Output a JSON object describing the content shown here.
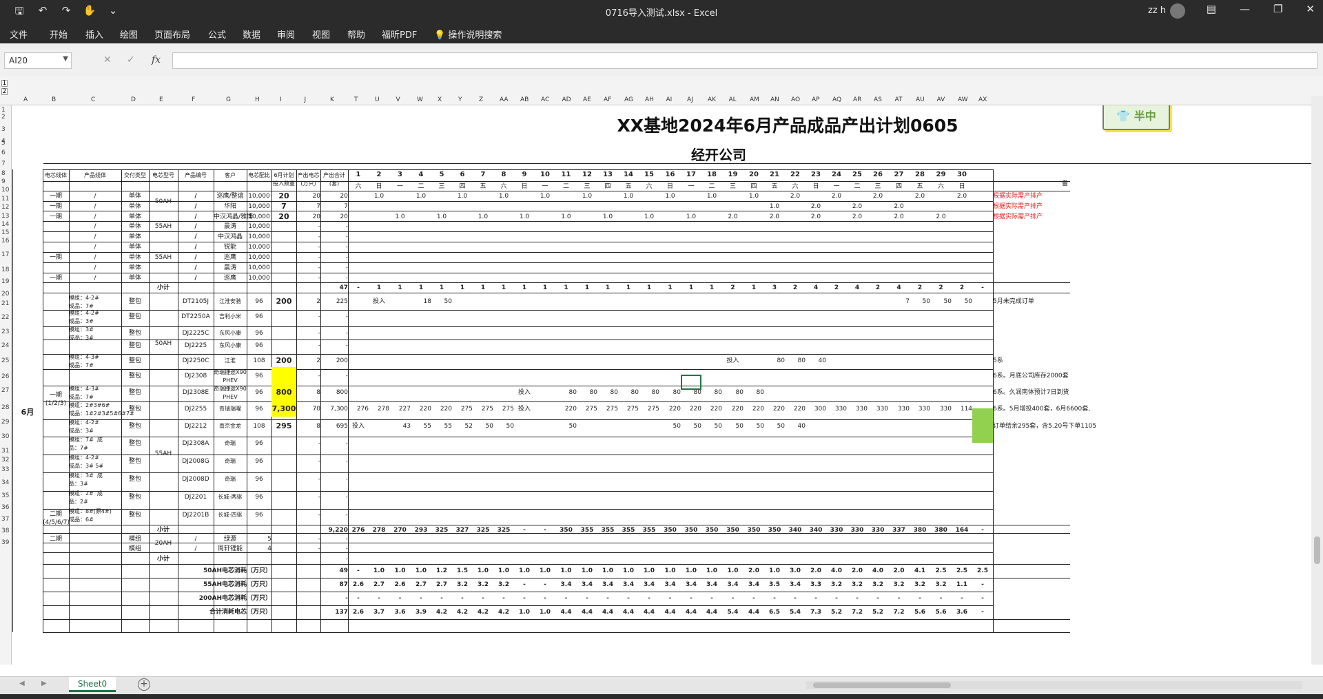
{
  "window": {
    "title": "0716导入测试.xlsx  -  Excel",
    "user": "zz h"
  },
  "menu": [
    "文件",
    "开始",
    "插入",
    "绘图",
    "页面布局",
    "公式",
    "数据",
    "审阅",
    "视图",
    "帮助",
    "福昕PDF",
    "操作说明搜索"
  ],
  "name_box": "AI20",
  "formula_value": "",
  "columns": [
    "A",
    "B",
    "C",
    "D",
    "E",
    "F",
    "G",
    "H",
    "I",
    "J",
    "K",
    "T",
    "U",
    "V",
    "W",
    "X",
    "Y",
    "Z",
    "AA",
    "AB",
    "AC",
    "AD",
    "AE",
    "AF",
    "AG",
    "AH",
    "AI",
    "AJ",
    "AK",
    "AL",
    "AM",
    "AN",
    "AO",
    "AP",
    "AQ",
    "AR",
    "AS",
    "AT",
    "AU",
    "AV",
    "AW",
    "AX"
  ],
  "rows": [
    "1",
    "2",
    "3",
    "4",
    "5",
    "6",
    "7",
    "8",
    "9",
    "10",
    "11",
    "12",
    "13",
    "14",
    "15",
    "16",
    "17",
    "18",
    "19",
    "20",
    "21",
    "22",
    "23",
    "24",
    "25",
    "26",
    "27",
    "28",
    "29",
    "30",
    "31",
    "32",
    "33",
    "34",
    "35",
    "36",
    "37",
    "38",
    "39"
  ],
  "sheet": {
    "title": "XX基地2024年6月产品成品产出计划0605",
    "company": "经开公司",
    "logo_text": "半中",
    "month": "6月",
    "headers": [
      "电芯线体",
      "产品线体",
      "交付类型",
      "电芯型号",
      "产品编号",
      "客户",
      "电芯配比",
      "6月计划投入数量",
      "产出电芯(万只)",
      "产出合计(套)"
    ],
    "days": [
      "1",
      "2",
      "3",
      "4",
      "5",
      "6",
      "7",
      "8",
      "9",
      "10",
      "11",
      "12",
      "13",
      "14",
      "15",
      "16",
      "17",
      "18",
      "19",
      "20",
      "21",
      "22",
      "23",
      "24",
      "25",
      "26",
      "27",
      "28",
      "29",
      "30"
    ],
    "weekdays": [
      "六",
      "日",
      "一",
      "二",
      "三",
      "四",
      "五",
      "六",
      "日",
      "一",
      "二",
      "三",
      "四",
      "五",
      "六",
      "日",
      "一",
      "二",
      "三",
      "四",
      "五",
      "六",
      "日",
      "一",
      "二",
      "三",
      "四",
      "五",
      "六",
      "日"
    ],
    "last_col": "备",
    "block1": [
      {
        "line": "一期",
        "pline": "/",
        "type": "单体",
        "cell": "50AH",
        "code": "/",
        "cust": "巡鹰/整谊",
        "ratio": "10,000",
        "plan": "20",
        "cells": "20",
        "total": "20",
        "note": "根据实际需产排产"
      },
      {
        "line": "一期",
        "pline": "/",
        "type": "单体",
        "cell": "",
        "code": "/",
        "cust": "华阳",
        "ratio": "10,000",
        "plan": "7",
        "cells": "7",
        "total": "7",
        "note": "根据实际需产排产"
      },
      {
        "line": "一期",
        "pline": "/",
        "type": "单体",
        "cell": "",
        "code": "/",
        "cust": "中汉鸿晶/雅博",
        "ratio": "10,000",
        "plan": "20",
        "cells": "20",
        "total": "20",
        "note": "根据实际需产排产"
      },
      {
        "line": "",
        "pline": "/",
        "type": "单体",
        "cell": "55AH",
        "code": "/",
        "cust": "晨涛",
        "ratio": "10,000",
        "plan": "",
        "cells": "-",
        "total": "-",
        "note": ""
      },
      {
        "line": "",
        "pline": "/",
        "type": "单体",
        "cell": "",
        "code": "/",
        "cust": "中汉鸿晶",
        "ratio": "10,000",
        "plan": "",
        "cells": "-",
        "total": "-",
        "note": ""
      },
      {
        "line": "",
        "pline": "/",
        "type": "单体",
        "cell": "",
        "code": "/",
        "cust": "锐能",
        "ratio": "10,000",
        "plan": "",
        "cells": "-",
        "total": "-",
        "note": ""
      },
      {
        "line": "一期",
        "pline": "/",
        "type": "单体",
        "cell": "55AH",
        "code": "/",
        "cust": "巡鹰",
        "ratio": "10,000",
        "plan": "",
        "cells": "-",
        "total": "-",
        "note": ""
      },
      {
        "line": "",
        "pline": "/",
        "type": "单体",
        "cell": "",
        "code": "/",
        "cust": "晨涛",
        "ratio": "10,000",
        "plan": "",
        "cells": "-",
        "total": "-",
        "note": ""
      },
      {
        "line": "一期",
        "pline": "/",
        "type": "单体",
        "cell": "",
        "code": "/",
        "cust": "巡鹰",
        "ratio": "10,000",
        "plan": "",
        "cells": "-",
        "total": "-",
        "note": ""
      }
    ],
    "subtotal_label": "小计",
    "block1_daily": [
      [
        "1.0",
        "",
        "1.0",
        "",
        "1.0",
        "",
        "1.0",
        "",
        "1.0",
        "",
        "1.0",
        "",
        "1.0",
        "",
        "1.0",
        "",
        "1.0",
        "",
        "1.0",
        "",
        "2.0",
        "",
        "2.0",
        "",
        "2.0",
        "",
        "2.0",
        "",
        "2.0"
      ],
      [
        "",
        "",
        "",
        "",
        "",
        "",
        "",
        "",
        "",
        "",
        "",
        "",
        "",
        "",
        "",
        "",
        "",
        "",
        "",
        "1.0",
        "",
        "2.0",
        "",
        "2.0",
        "",
        "2.0",
        "",
        "",
        ""
      ],
      [
        "",
        "1.0",
        "",
        "1.0",
        "",
        "1.0",
        "",
        "1.0",
        "",
        "1.0",
        "",
        "1.0",
        "",
        "1.0",
        "",
        "1.0",
        "",
        "2.0",
        "",
        "2.0",
        "",
        "2.0",
        "",
        "2.0",
        "",
        "2.0",
        "",
        "2.0",
        ""
      ]
    ],
    "block1_sub": {
      "total": "47",
      "days": [
        "-",
        "1",
        "1",
        "1",
        "1",
        "1",
        "1",
        "1",
        "1",
        "1",
        "1",
        "1",
        "1",
        "1",
        "1",
        "1",
        "1",
        "1",
        "2",
        "1",
        "3",
        "2",
        "4",
        "2",
        "4",
        "2",
        "4",
        "2",
        "2",
        "2",
        "-"
      ]
    },
    "phase1_label": "一期\n(1/2/3)",
    "phase2_label": "二期\n(4/5/6/7)",
    "block2": [
      {
        "pl": "模组：4-2#\n成品：7#",
        "type": "整包",
        "code": "DT2105J",
        "cust": "江淮安驰",
        "ratio": "96",
        "plan": "200",
        "cells": "2",
        "total": "225",
        "note": "5月未完成订单"
      },
      {
        "pl": "模组：4-2#\n成品：3#",
        "type": "整包",
        "code": "DT2250A",
        "cust": "吉利小米",
        "ratio": "96",
        "plan": "",
        "cells": "-",
        "total": "-",
        "note": ""
      },
      {
        "pl": "模组：3#\n成品：3#",
        "type": "整包",
        "code": "DJ2225C",
        "cust": "东风小康",
        "ratio": "96",
        "plan": "",
        "cells": "-",
        "total": "-",
        "note": ""
      },
      {
        "pl": "",
        "type": "整包",
        "code": "DJ2225",
        "cust": "东风小康",
        "ratio": "96",
        "plan": "",
        "cells": "-",
        "total": "-",
        "note": ""
      },
      {
        "pl": "模组：4-3#\n成品：7#",
        "type": "整包",
        "code": "DJ2250C",
        "cust": "江淮",
        "ratio": "108",
        "plan": "200",
        "cells": "2",
        "total": "200",
        "note": "5系"
      },
      {
        "pl": "",
        "type": "整包",
        "code": "DJ2308",
        "cust": "奇瑞捷途X90\nPHEV",
        "ratio": "96",
        "plan": "",
        "cells": "-",
        "total": "-",
        "note": "6系。月底公司库存2000套"
      },
      {
        "pl": "模组：4-3#\n成品：7#",
        "type": "整包",
        "code": "DJ2308E",
        "cust": "奇瑞捷途X90\nPHEV",
        "ratio": "96",
        "plan": "800",
        "cells": "8",
        "total": "800",
        "note": "6系。久润南体预计7日到货"
      },
      {
        "pl": "模组：2#3#6#\n成品：1#2#3#5#6#7#",
        "type": "整包",
        "code": "DJ2255",
        "cust": "奇瑞瑞曜",
        "ratio": "96",
        "plan": "7,300",
        "cells": "70",
        "total": "7,300",
        "note": "6系。5月增投400套，6月6600套,"
      },
      {
        "pl": "模组：4-2#\n成品：3#",
        "type": "整包",
        "code": "DJ2212",
        "cust": "南京金龙",
        "ratio": "108",
        "plan": "295",
        "cells": "8",
        "total": "695",
        "note": "订单结余295套，含5.20号下单1105"
      },
      {
        "pl": "模组：7#  成\n品：7#",
        "type": "整包",
        "code": "DJ2308A",
        "cust": "奇瑞",
        "ratio": "96",
        "plan": "",
        "cells": "-",
        "total": "-",
        "note": ""
      },
      {
        "pl": "模组：4-2#\n成品：3# 5#",
        "type": "整包",
        "code": "DJ2008G",
        "cust": "奇瑞",
        "ratio": "96",
        "plan": "",
        "cells": "-",
        "total": "-",
        "note": ""
      },
      {
        "pl": "模组：3#  成\n品：3#",
        "type": "整包",
        "code": "DJ2008D",
        "cust": "奇瑞",
        "ratio": "96",
        "plan": "",
        "cells": "-",
        "total": "-",
        "note": ""
      },
      {
        "pl": "模组：2#  成\n品：2#",
        "type": "整包",
        "code": "DJ2201",
        "cust": "长城-两驱",
        "ratio": "96",
        "plan": "",
        "cells": "-",
        "total": "-",
        "note": ""
      },
      {
        "pl": "模组：8#(原4#)\n成品：6#",
        "type": "整包",
        "code": "DJ2201B",
        "cust": "长城-四驱",
        "ratio": "96",
        "plan": "",
        "cells": "-",
        "total": "-",
        "note": ""
      }
    ],
    "block2_daily": [
      [
        "",
        "投入",
        "",
        "18",
        "50",
        "",
        "",
        "",
        "",
        "",
        "",
        "",
        "",
        "",
        "",
        "",
        "",
        "",
        "",
        "",
        "",
        "",
        "",
        "",
        "",
        "",
        "7",
        "50",
        "50",
        "50"
      ],
      [],
      [],
      [],
      [
        "",
        "",
        "",
        "",
        "",
        "",
        "",
        "",
        "",
        "",
        "",
        "",
        "",
        "",
        "",
        "",
        "",
        "",
        "投入",
        "",
        "80",
        "80",
        "40",
        "",
        "",
        "",
        "",
        "",
        "",
        ""
      ],
      [],
      [
        "",
        "",
        "",
        "",
        "",
        "",
        "",
        "",
        "投入",
        "",
        "80",
        "80",
        "80",
        "80",
        "80",
        "80",
        "80",
        "80",
        "80",
        "80",
        "",
        "",
        "",
        "",
        "",
        "",
        "",
        "",
        "",
        ""
      ],
      [
        "276",
        "278",
        "227",
        "220",
        "220",
        "275",
        "275",
        "275",
        "投入",
        "",
        "220",
        "275",
        "275",
        "275",
        "275",
        "220",
        "220",
        "220",
        "220",
        "220",
        "220",
        "220",
        "300",
        "330",
        "330",
        "330",
        "330",
        "330",
        "330",
        "114"
      ],
      [
        "投入",
        "",
        "43",
        "55",
        "55",
        "52",
        "50",
        "50",
        "",
        "",
        "50",
        "",
        "",
        "",
        "",
        "50",
        "50",
        "50",
        "50",
        "50",
        "50",
        "40",
        "",
        "",
        "",
        "",
        "",
        "",
        "",
        ""
      ]
    ],
    "block2_sub": {
      "total": "9,220",
      "days": [
        "276",
        "278",
        "270",
        "293",
        "325",
        "327",
        "325",
        "325",
        "-",
        "-",
        "350",
        "355",
        "355",
        "355",
        "355",
        "350",
        "350",
        "350",
        "350",
        "350",
        "350",
        "340",
        "340",
        "330",
        "330",
        "330",
        "337",
        "380",
        "380",
        "164",
        "-"
      ]
    },
    "block3": [
      {
        "line": "二期",
        "type": "模组",
        "cell": "20AH",
        "code": "/",
        "cust": "绿源",
        "ratio": "5",
        "cells": "-",
        "total": "-"
      },
      {
        "line": "",
        "type": "模组",
        "cell": "",
        "code": "/",
        "cust": "周轩锂能",
        "ratio": "4",
        "cells": "-",
        "total": "-"
      }
    ],
    "block3_sub": "-",
    "consumption": [
      {
        "label": "50AH电芯消耗（万只）",
        "total": "49",
        "days": [
          "-",
          "1.0",
          "1.0",
          "1.0",
          "1.2",
          "1.5",
          "1.0",
          "1.0",
          "1.0",
          "1.0",
          "1.0",
          "1.0",
          "1.0",
          "1.0",
          "1.0",
          "1.0",
          "1.0",
          "1.0",
          "1.0",
          "2.0",
          "1.0",
          "3.0",
          "2.0",
          "4.0",
          "2.0",
          "4.0",
          "2.0",
          "4.1",
          "2.5",
          "2.5",
          "2.5",
          "-"
        ]
      },
      {
        "label": "55AH电芯消耗（万只）",
        "total": "87",
        "days": [
          "2.6",
          "2.7",
          "2.6",
          "2.7",
          "2.7",
          "3.2",
          "3.2",
          "3.2",
          "-",
          "-",
          "3.4",
          "3.4",
          "3.4",
          "3.4",
          "3.4",
          "3.4",
          "3.4",
          "3.4",
          "3.4",
          "3.4",
          "3.5",
          "3.4",
          "3.3",
          "3.2",
          "3.2",
          "3.2",
          "3.2",
          "3.2",
          "3.2",
          "1.1",
          "-"
        ]
      },
      {
        "label": "200AH电芯消耗（万只）",
        "total": "-",
        "days": [
          "-",
          "-",
          "-",
          "-",
          "-",
          "-",
          "-",
          "-",
          "-",
          "-",
          "-",
          "-",
          "-",
          "-",
          "-",
          "-",
          "-",
          "-",
          "-",
          "-",
          "-",
          "-",
          "-",
          "-",
          "-",
          "-",
          "-",
          "-",
          "-",
          "-",
          "-"
        ]
      },
      {
        "label": "合计消耗电芯（万只）",
        "total": "137",
        "days": [
          "2.6",
          "3.7",
          "3.6",
          "3.9",
          "4.2",
          "4.2",
          "4.2",
          "4.2",
          "1.0",
          "1.0",
          "4.4",
          "4.4",
          "4.4",
          "4.4",
          "4.4",
          "4.4",
          "4.4",
          "4.4",
          "5.4",
          "4.4",
          "6.5",
          "5.4",
          "7.3",
          "5.2",
          "7.2",
          "5.2",
          "7.2",
          "5.6",
          "5.6",
          "3.6",
          "-"
        ]
      }
    ]
  },
  "sheet_tab": "Sheet0"
}
